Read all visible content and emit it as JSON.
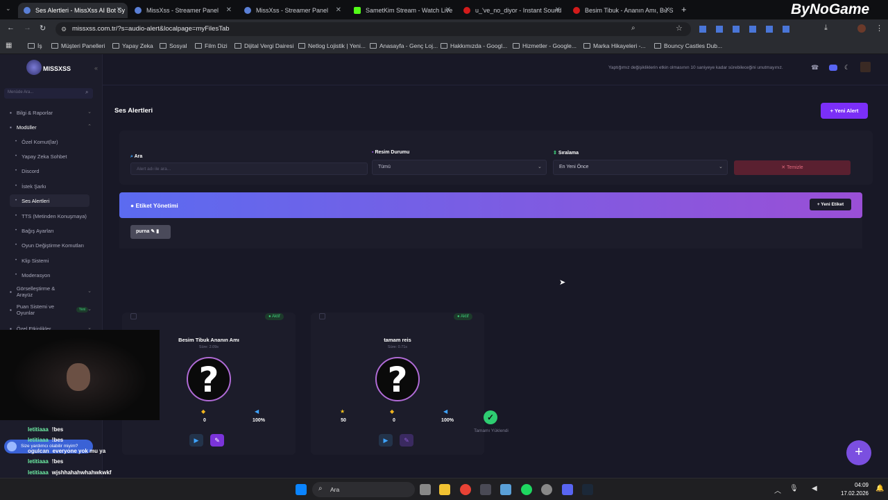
{
  "browser": {
    "tabs": [
      {
        "title": "Ses Alertleri - MissXss AI Bot Sy",
        "active": true
      },
      {
        "title": "MissXss - Streamer Panel"
      },
      {
        "title": "MissXss - Streamer Panel"
      },
      {
        "title": "SametKim Stream - Watch Live"
      },
      {
        "title": "u_'ve_no_diyor - Instant Sound"
      },
      {
        "title": "Besim Tibuk - Ananın Amı, Bu S"
      }
    ],
    "url": "missxss.com.tr/?s=audio-alert&localpage=myFilesTab",
    "bookmarks": [
      "İş",
      "Müşteri Panelleri",
      "Yapay Zeka",
      "Sosyal",
      "Film Dizi",
      "Dijital Vergi Dairesi",
      "Netlog Lojistik | Yeni...",
      "Anasayfa - Genç Loj...",
      "Hakkımızda - Googl...",
      "Hizmetler - Google...",
      "Marka Hikayeleri -...",
      "Bouncy Castles Dub..."
    ]
  },
  "watermark": "ByNoGame",
  "app": {
    "logo": "MISSXSS",
    "notice": "Yaptığımız değişikliklerin etkin olmasının 10 saniyeye kadar sürebileceğini unutmayınız.",
    "search_placeholder": "Menüde Ara...",
    "sidebar": [
      {
        "label": "Bilgi & Raporlar",
        "type": "group"
      },
      {
        "label": "Modüller",
        "type": "group-open"
      },
      {
        "label": "Özel Komut(lar)",
        "type": "sub"
      },
      {
        "label": "Yapay Zeka Sohbet",
        "type": "sub"
      },
      {
        "label": "Discord",
        "type": "sub"
      },
      {
        "label": "İstek Şarkı",
        "type": "sub"
      },
      {
        "label": "Ses Alertleri",
        "type": "sub",
        "active": true
      },
      {
        "label": "TTS (Metinden Konuşmaya)",
        "type": "sub"
      },
      {
        "label": "Bağış Ayarları",
        "type": "sub"
      },
      {
        "label": "Oyun Değiştirme Komutları",
        "type": "sub"
      },
      {
        "label": "Klip Sistemi",
        "type": "sub"
      },
      {
        "label": "Moderasyon",
        "type": "sub"
      },
      {
        "label": "Görselleştirme & Arayüz",
        "type": "group"
      },
      {
        "label": "Puan Sistemi ve Oyunlar",
        "type": "group",
        "badge": "Yeni"
      },
      {
        "label": "Özel Etkinlikler",
        "type": "group"
      }
    ],
    "page_title": "Ses Alertleri",
    "new_alert_label": "Yeni Alert",
    "filters": {
      "search_label": "Ara",
      "search_placeholder": "Alert adı ile ara...",
      "image_status_label": "Resim Durumu",
      "image_status_value": "Tümü",
      "sort_label": "Sıralama",
      "sort_value": "En Yeni Önce",
      "clear_label": "Temizle"
    },
    "tag_panel": {
      "title": "Etiket Yönetimi",
      "new_tag_label": "Yeni Etiket",
      "tags": [
        "purna"
      ]
    },
    "alerts": [
      {
        "name": "Besim Tibuk Ananın Amı",
        "duration": "Süre: 2.09s",
        "status": "Aktif",
        "stats": [
          {
            "icon": "coin",
            "value": "0"
          },
          {
            "icon": "volume",
            "value": "100%"
          }
        ]
      },
      {
        "name": "tamam reis",
        "duration": "Süre: 0.71s",
        "status": "Aktif",
        "stats": [
          {
            "icon": "star",
            "value": "50"
          },
          {
            "icon": "coin",
            "value": "0"
          },
          {
            "icon": "volume",
            "value": "100%"
          }
        ]
      }
    ],
    "loaded_text": "Tamamı Yüklendi"
  },
  "chat": [
    {
      "user": "letitiaaa",
      "msg": "!bes"
    },
    {
      "user": "letitiaaa",
      "msg": "!bes"
    },
    {
      "user": "ogulcan",
      "msg": "everyone yok mu ya"
    },
    {
      "user": "letitiaaa",
      "msg": "!bes"
    },
    {
      "user": "letitiaaa",
      "msg": "wjshhahahwhahwkwkf"
    },
    {
      "user": "ogulcan",
      "msg": ""
    },
    {
      "user": "letitiaaa",
      "msg": ""
    }
  ],
  "chat_popup": "Size yardımcı olabilir miyim?",
  "taskbar": {
    "search_label": "Ara",
    "time": "04:09",
    "date": "17.02.2026"
  },
  "colors": {
    "accent": "#7b2ff7",
    "bg": "#181826",
    "sidebar": "#1c1c2a",
    "banner_start": "#5b6bf0",
    "banner_end": "#9a4fd6"
  }
}
